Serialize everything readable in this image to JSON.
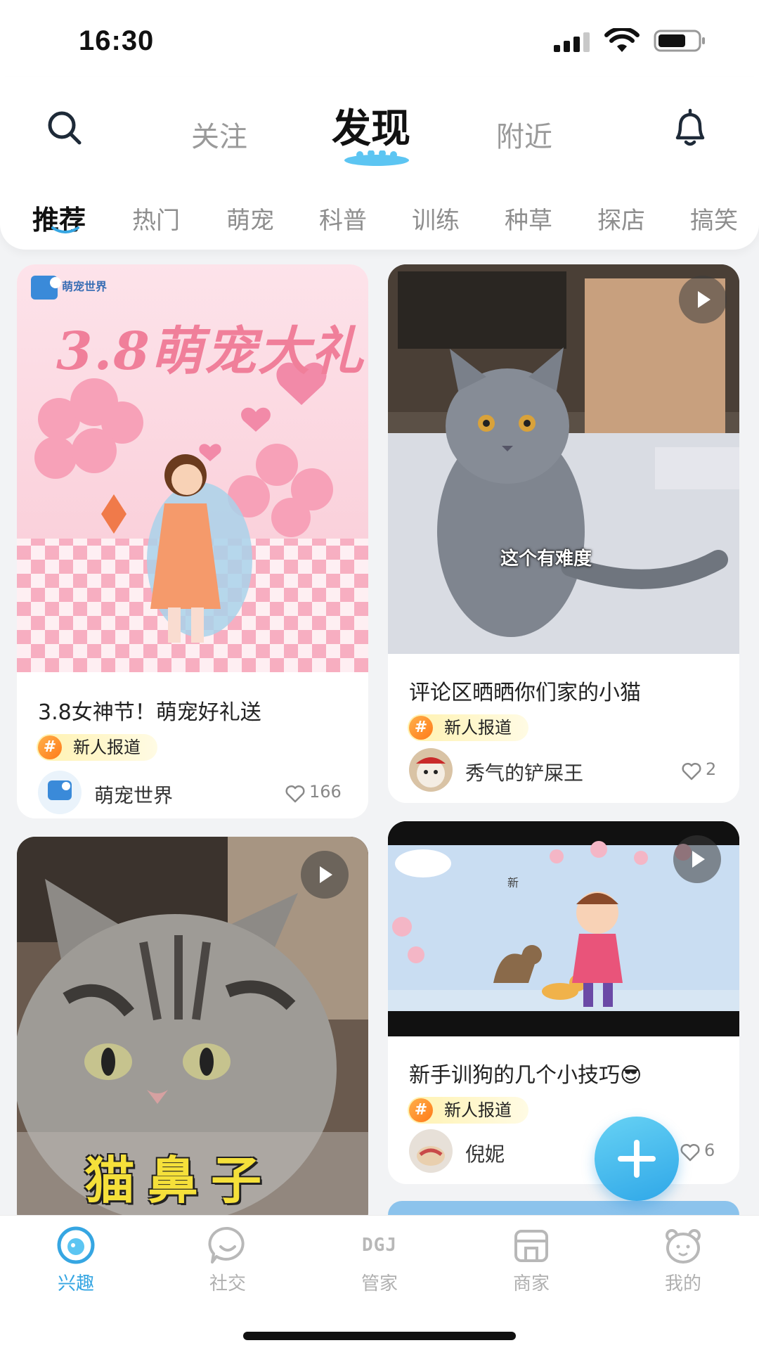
{
  "status_bar": {
    "time": "16:30"
  },
  "header": {
    "search_icon": "search-icon",
    "bell_icon": "bell-icon",
    "main_tabs": [
      {
        "label": "关注",
        "active": false
      },
      {
        "label": "发现",
        "active": true
      },
      {
        "label": "附近",
        "active": false
      }
    ],
    "sub_tabs": [
      {
        "label": "推荐",
        "active": true
      },
      {
        "label": "热门"
      },
      {
        "label": "萌宠"
      },
      {
        "label": "科普"
      },
      {
        "label": "训练"
      },
      {
        "label": "种草"
      },
      {
        "label": "探店"
      },
      {
        "label": "搞笑"
      }
    ]
  },
  "feed": {
    "posts": [
      {
        "image_text": "3.8萌宠大礼",
        "image_brand": "萌宠世界",
        "title": "3.8女神节！萌宠好礼送",
        "tag": "新人报道",
        "author": "萌宠世界",
        "likes": "166",
        "is_video": false
      },
      {
        "image_caption": "这个有难度",
        "title": "评论区晒晒你们家的小猫",
        "tag": "新人报道",
        "author": "秀气的铲屎王",
        "likes": "2",
        "is_video": true
      },
      {
        "image_caption": "猫鼻子",
        "is_video": true
      },
      {
        "image_text": "新",
        "title": "新手训狗的几个小技巧😎",
        "tag": "新人报道",
        "author": "倪妮",
        "likes": "6",
        "is_video": true
      }
    ],
    "tag_symbol": "#"
  },
  "fab": {
    "icon": "plus-icon"
  },
  "bottom_nav": {
    "items": [
      {
        "label": "兴趣",
        "icon": "interest-icon",
        "active": true
      },
      {
        "label": "社交",
        "icon": "chat-icon",
        "active": false
      },
      {
        "label": "管家",
        "icon": "dgj-logo-icon",
        "icon_text": "DGJ",
        "active": false
      },
      {
        "label": "商家",
        "icon": "store-icon",
        "active": false
      },
      {
        "label": "我的",
        "icon": "bear-icon",
        "active": false
      }
    ]
  },
  "colors": {
    "accent": "#36a6e2",
    "tag_bg": "#fff2b0",
    "tag_hash": "#ff8a1f",
    "page_bg": "#f2f3f5"
  }
}
